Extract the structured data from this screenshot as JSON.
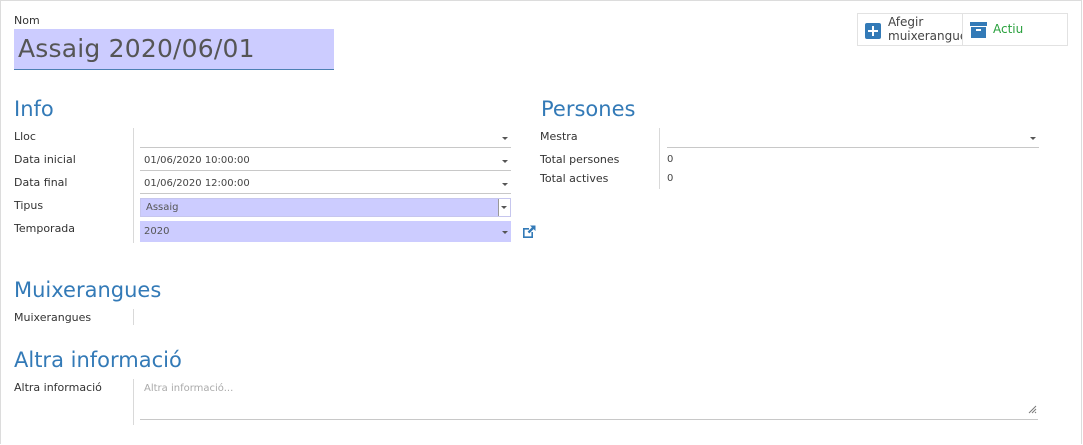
{
  "name": {
    "label": "Nom",
    "value": "Assaig 2020/06/01"
  },
  "buttons": {
    "add_label_line1": "Afegir",
    "add_label_line2": "muixerangue",
    "active_label": "Actiu"
  },
  "info": {
    "title": "Info",
    "lloc": {
      "label": "Lloc",
      "value": ""
    },
    "data_inicial": {
      "label": "Data inicial",
      "value": "01/06/2020 10:00:00"
    },
    "data_final": {
      "label": "Data final",
      "value": "01/06/2020 12:00:00"
    },
    "tipus": {
      "label": "Tipus",
      "value": "Assaig"
    },
    "temporada": {
      "label": "Temporada",
      "value": "2020"
    }
  },
  "persones": {
    "title": "Persones",
    "mestra": {
      "label": "Mestra",
      "value": ""
    },
    "total_persones": {
      "label": "Total persones",
      "value": "0"
    },
    "total_actives": {
      "label": "Total actives",
      "value": "0"
    }
  },
  "muixerangues": {
    "title": "Muixerangues",
    "field_label": "Muixerangues"
  },
  "altra": {
    "title": "Altra informació",
    "field_label": "Altra informació",
    "placeholder": "Altra informació..."
  },
  "colors": {
    "accent": "#337ab7",
    "highlight": "#ccccff",
    "active_green": "#28a03c"
  },
  "icons": [
    "plus-square-icon",
    "archive-icon",
    "external-link-icon",
    "dropdown-caret-icon",
    "resize-handle-icon"
  ]
}
